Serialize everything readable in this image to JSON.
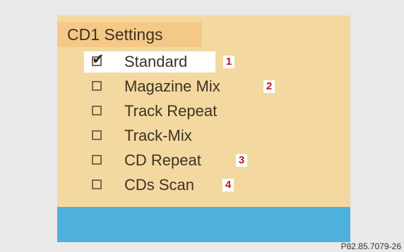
{
  "screen": {
    "title": "CD1 Settings",
    "items": [
      {
        "label": "Standard",
        "checked": true,
        "marker": "1"
      },
      {
        "label": "Magazine  Mix",
        "checked": false,
        "marker": "2"
      },
      {
        "label": "Track Repeat",
        "checked": false,
        "marker": ""
      },
      {
        "label": "Track-Mix",
        "checked": false,
        "marker": ""
      },
      {
        "label": "CD Repeat",
        "checked": false,
        "marker": "3"
      },
      {
        "label": "CDs Scan",
        "checked": false,
        "marker": "4"
      }
    ]
  },
  "caption": "P82.85.7079-26",
  "colors": {
    "panel": "#f3d9a0",
    "title_bg": "#f4c886",
    "bottom_bar": "#4eb1dd",
    "marker_text": "#c1121c"
  },
  "icons": {
    "checkbox": "checkbox-icon",
    "checkmark": "checkmark-icon"
  }
}
